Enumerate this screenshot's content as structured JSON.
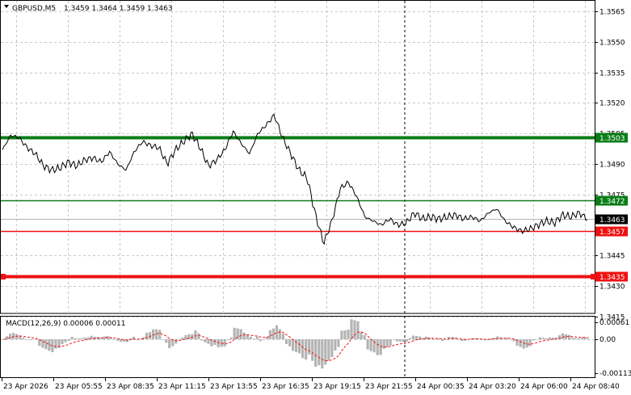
{
  "header": {
    "symbol": "GBPUSD,M5",
    "ohlc": "1.3459 1.3464 1.3459 1.3463",
    "menu_icon": "triangle-down-icon"
  },
  "price_axis": {
    "ticks": [
      "1.3565",
      "1.3550",
      "1.3535",
      "1.3520",
      "1.3505",
      "1.3490",
      "1.3475",
      "1.3445",
      "1.3430",
      "1.3415"
    ]
  },
  "levels": [
    {
      "value": 1.3503,
      "label": "1.3503",
      "color": "#0a7d17",
      "weight": "thick"
    },
    {
      "value": 1.3472,
      "label": "1.3472",
      "color": "#0a7d17",
      "weight": "thin"
    },
    {
      "value": 1.3457,
      "label": "1.3457",
      "color": "#ee1111",
      "weight": "thin"
    },
    {
      "value": 1.3435,
      "label": "1.3435",
      "color": "#ee1111",
      "weight": "thick"
    }
  ],
  "current_price": {
    "value": 1.3463,
    "label": "1.3463",
    "color": "#000000"
  },
  "macd": {
    "title": "MACD(12,26,9) 0.00006 0.00011",
    "ticks": [
      "0.00061",
      "0.00",
      "-0.00113"
    ]
  },
  "time_axis": {
    "labels": [
      "23 Apr 2026",
      "23 Apr 05:55",
      "23 Apr 08:35",
      "23 Apr 11:15",
      "23 Apr 13:55",
      "23 Apr 16:35",
      "23 Apr 19:15",
      "23 Apr 21:55",
      "24 Apr 00:35",
      "24 Apr 03:20",
      "24 Apr 06:00",
      "24 Apr 08:40"
    ]
  },
  "colors": {
    "price_line": "#000000",
    "grid": "#c8c8c8",
    "histogram": "#b4b4b4",
    "signal": "#ee1111",
    "separator": "#000000"
  },
  "chart_data": {
    "type": "line",
    "series": [
      {
        "values": [
          1.3497,
          1.3504,
          1.3503,
          1.3498,
          1.3495,
          1.3489,
          1.3487,
          1.3488,
          1.3491,
          1.3489,
          1.3492,
          1.3493,
          1.3491,
          1.3496,
          1.349,
          1.3487,
          1.3496,
          1.3501,
          1.3499,
          1.3498,
          1.349,
          1.3497,
          1.3501,
          1.3505,
          1.3498,
          1.3489,
          1.3492,
          1.3497,
          1.3506,
          1.35,
          1.3495,
          1.3505,
          1.3509,
          1.3514,
          1.3503,
          1.3495,
          1.3487,
          1.3483,
          1.3465,
          1.3451,
          1.3462,
          1.3478,
          1.3481,
          1.3474,
          1.3464,
          1.3462,
          1.346,
          1.3463,
          1.346,
          1.3461,
          1.3466,
          1.3463,
          1.3464,
          1.3463,
          1.3464,
          1.3465,
          1.3463,
          1.3464,
          1.3462,
          1.3466,
          1.3468,
          1.3462,
          1.3459,
          1.3457,
          1.3458,
          1.346,
          1.3462,
          1.3461,
          1.3465,
          1.3464,
          1.3466,
          1.3463
        ]
      }
    ]
  }
}
